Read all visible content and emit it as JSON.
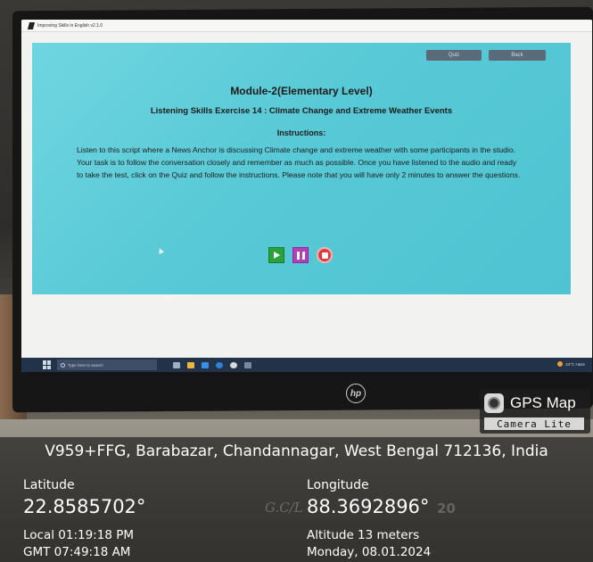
{
  "window": {
    "title": "Improving Skills in English v2.1.0"
  },
  "app": {
    "quiz_label": "Quiz",
    "back_label": "Back",
    "module_title": "Module-2(Elementary Level)",
    "exercise_title": "Listening Skills Exercise 14 : Climate Change and Extreme Weather Events",
    "instructions_heading": "Instructions:",
    "instructions_text": "Listen to this script where a News Anchor is discussing Climate change and extreme weather with some participants in the studio. Your task is to follow the conversation closely and remember as much as possible. Once you have listened to the audio and ready to take the test, click on the Quiz and follow the instructions. Please note that you will have only 2 minutes to answer the questions.",
    "controls": {
      "play_icon": "play-icon",
      "pause_icon": "pause-icon",
      "stop_icon": "stop-icon"
    },
    "colors": {
      "panel": "#58c9d6",
      "play": "#2aa23a",
      "pause": "#b33fbf",
      "stop": "#e23a3a",
      "top_button": "#5a6a78"
    }
  },
  "taskbar": {
    "search_placeholder": "Type here to search",
    "weather": "24°C Haze"
  },
  "monitor": {
    "brand": "hp"
  },
  "gps": {
    "title": "GPS Map",
    "subtitle": "Camera Lite",
    "address": "V959+FFG, Barabazar, Chandannagar, West Bengal 712136, India",
    "latitude_label": "Latitude",
    "latitude_value": "22.8585702°",
    "longitude_label": "Longitude",
    "longitude_value": "88.3692896°",
    "local_time": "Local 01:19:18 PM",
    "gmt_time": "GMT 07:49:18 AM",
    "altitude": "Altitude 13 meters",
    "date": "Monday, 08.01.2024",
    "watermark": "G.C/L",
    "watermark_suffix": "20"
  }
}
